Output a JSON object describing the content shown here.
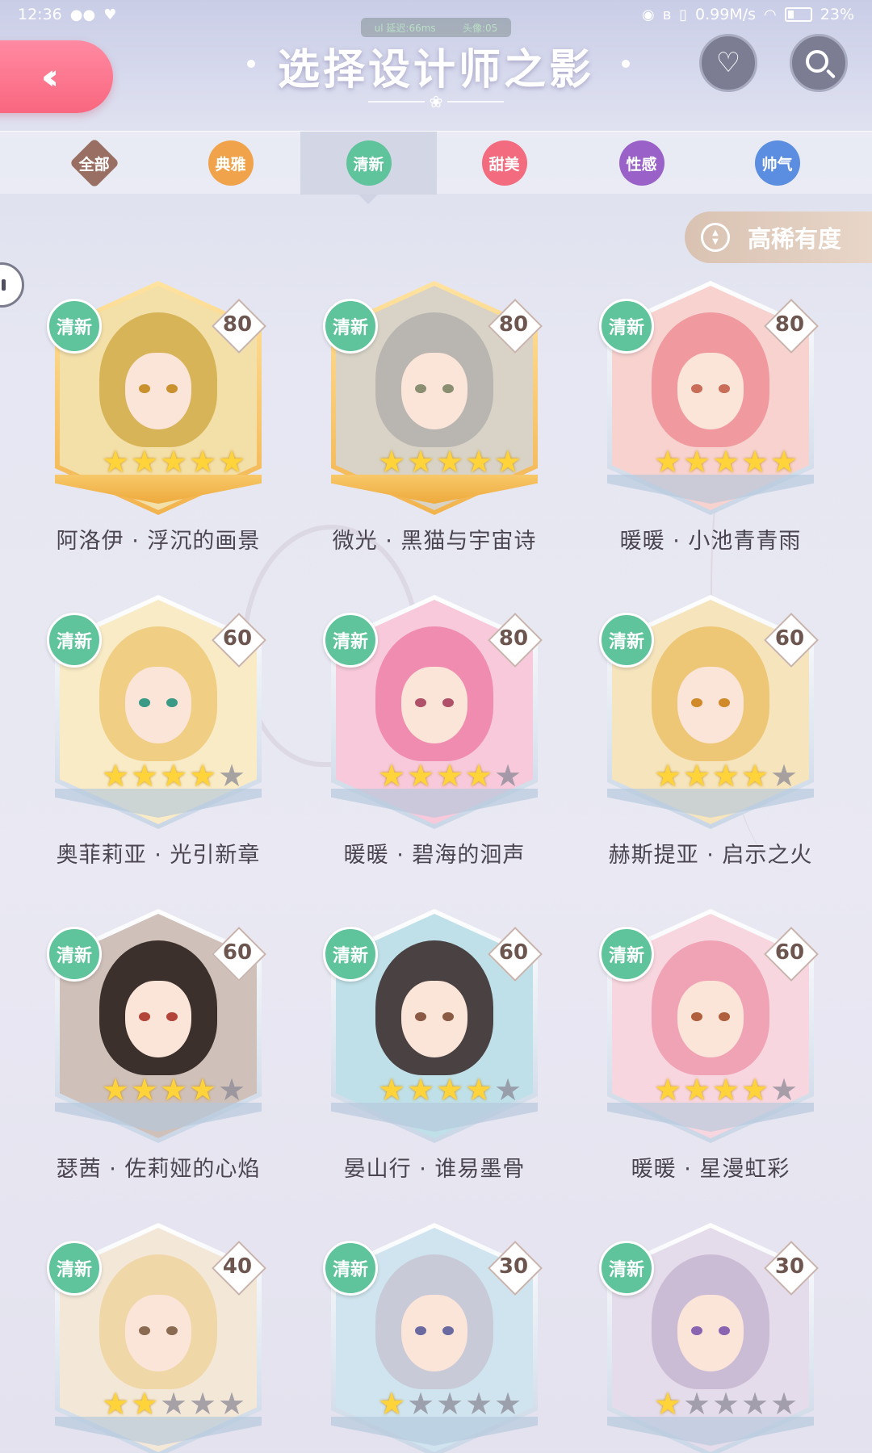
{
  "status_bar": {
    "time": "12:36",
    "speed": "0.99M/s",
    "battery": "23%"
  },
  "header": {
    "title": "选择设计师之影",
    "fps_left": "ul 延迟:66ms",
    "fps_right": "头像:05"
  },
  "tabs": [
    {
      "label": "全部",
      "color": "#9a6f63",
      "shape": "diamond"
    },
    {
      "label": "典雅",
      "color": "#f0a34a",
      "shape": "circle"
    },
    {
      "label": "清新",
      "color": "#5fc39c",
      "shape": "circle",
      "active": true
    },
    {
      "label": "甜美",
      "color": "#f26b7e",
      "shape": "circle"
    },
    {
      "label": "性感",
      "color": "#9a62c8",
      "shape": "circle"
    },
    {
      "label": "帅气",
      "color": "#5b8de0",
      "shape": "circle"
    }
  ],
  "sort": {
    "label": "高稀有度",
    "icon": "sort-updown-icon"
  },
  "cards": [
    {
      "name": "阿洛伊 · 浮沉的画景",
      "style": "清新",
      "level": "80",
      "stars": 5,
      "max_stars": 5,
      "frame": "gold",
      "hair": "#d8b458",
      "bg": "#f3dfa8",
      "eye": "#c9922e"
    },
    {
      "name": "微光 · 黑猫与宇宙诗",
      "style": "清新",
      "level": "80",
      "stars": 5,
      "max_stars": 5,
      "frame": "gold",
      "hair": "#b9b6b2",
      "bg": "#d8d3c6",
      "eye": "#8a8f72"
    },
    {
      "name": "暖暖 · 小池青青雨",
      "style": "清新",
      "level": "80",
      "stars": 5,
      "max_stars": 5,
      "frame": "silver",
      "hair": "#f09aa0",
      "bg": "#f7d2cf",
      "eye": "#c96d58"
    },
    {
      "name": "奥菲莉亚 · 光引新章",
      "style": "清新",
      "level": "60",
      "stars": 4,
      "max_stars": 5,
      "frame": "silver",
      "hair": "#f0cf84",
      "bg": "#f8ebc6",
      "eye": "#3a9a86"
    },
    {
      "name": "暖暖 · 碧海的洄声",
      "style": "清新",
      "level": "80",
      "stars": 4,
      "max_stars": 5,
      "frame": "silver",
      "hair": "#f08cb0",
      "bg": "#f7c9da",
      "eye": "#b0516a"
    },
    {
      "name": "赫斯提亚 · 启示之火",
      "style": "清新",
      "level": "60",
      "stars": 4,
      "max_stars": 5,
      "frame": "silver",
      "hair": "#edc775",
      "bg": "#f5e4bc",
      "eye": "#d08a2a"
    },
    {
      "name": "瑟茜 · 佐莉娅的心焰",
      "style": "清新",
      "level": "60",
      "stars": 4,
      "max_stars": 5,
      "frame": "silver",
      "hair": "#3b302c",
      "bg": "#cfc0b9",
      "eye": "#b2443a"
    },
    {
      "name": "晏山行 · 谁易墨骨",
      "style": "清新",
      "level": "60",
      "stars": 4,
      "max_stars": 5,
      "frame": "silver",
      "hair": "#4a4142",
      "bg": "#bfe0e8",
      "eye": "#8a5a45"
    },
    {
      "name": "暖暖 · 星漫虹彩",
      "style": "清新",
      "level": "60",
      "stars": 4,
      "max_stars": 5,
      "frame": "silver",
      "hair": "#f1a3b6",
      "bg": "#f8d6df",
      "eye": "#b0603e"
    },
    {
      "name": "",
      "style": "清新",
      "level": "40",
      "stars": 2,
      "max_stars": 5,
      "frame": "silver",
      "hair": "#f0d7a8",
      "bg": "#f3e8d8",
      "eye": "#8a6a50"
    },
    {
      "name": "",
      "style": "清新",
      "level": "30",
      "stars": 1,
      "max_stars": 5,
      "frame": "silver",
      "hair": "#c8cad8",
      "bg": "#cfe4ee",
      "eye": "#6a6aa0"
    },
    {
      "name": "",
      "style": "清新",
      "level": "30",
      "stars": 1,
      "max_stars": 5,
      "frame": "silver",
      "hair": "#cbbcd6",
      "bg": "#e4dcea",
      "eye": "#8a64b0"
    }
  ]
}
